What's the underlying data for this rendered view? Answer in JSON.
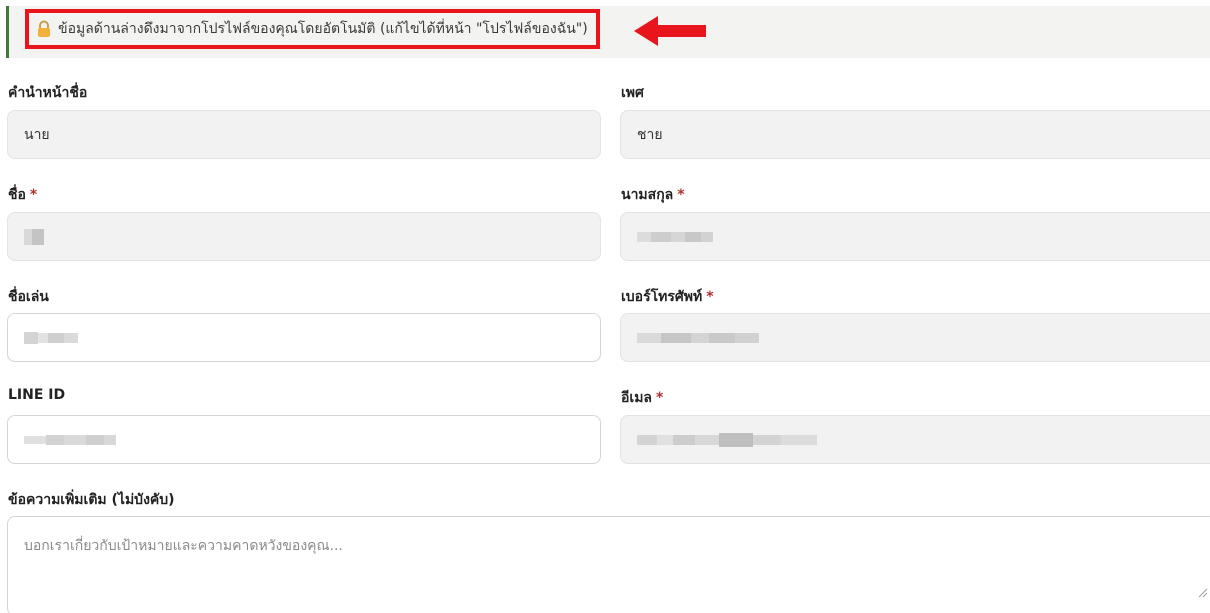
{
  "notice": {
    "text": "ข้อมูลด้านล่างดึงมาจากโปรไฟล์ของคุณโดยอัตโนมัติ (แก้ไขได้ที่หน้า \"โปรไฟล์ของฉัน\")",
    "icon": "lock-icon"
  },
  "form": {
    "title_prefix": {
      "label": "คำนำหน้าชื่อ",
      "value": "นาย"
    },
    "gender": {
      "label": "เพศ",
      "value": "ชาย"
    },
    "first_name": {
      "label": "ชื่อ",
      "required_mark": "*"
    },
    "last_name": {
      "label": "นามสกุล",
      "required_mark": "*"
    },
    "nickname": {
      "label": "ชื่อเล่น"
    },
    "phone": {
      "label": "เบอร์โทรศัพท์",
      "required_mark": "*"
    },
    "line_id": {
      "label": "LINE ID"
    },
    "email": {
      "label": "อีเมล",
      "required_mark": "*"
    },
    "note": {
      "label": "ข้อความเพิ่มเติม (ไม่บังคับ)",
      "placeholder": "บอกเราเกี่ยวกับเป้าหมายและความคาดหวังของคุณ..."
    }
  },
  "colors": {
    "highlight_border": "#e8151d",
    "arrow": "#e8151d",
    "banner_accent": "#3f7a3a",
    "required": "#b3302a"
  }
}
